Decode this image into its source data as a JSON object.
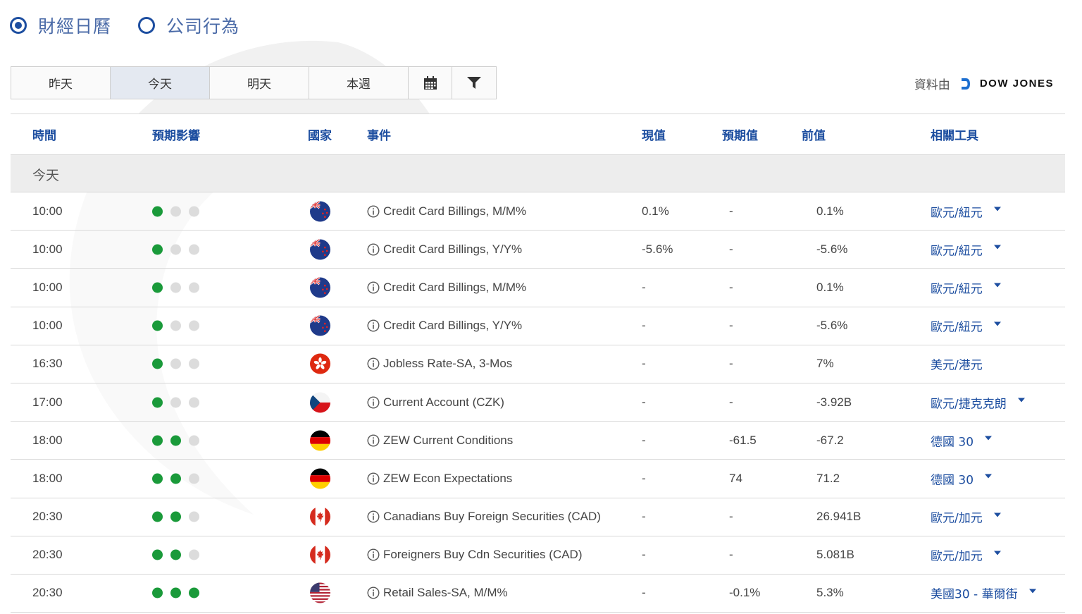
{
  "mode_options": [
    {
      "label": "財經日曆",
      "checked": true
    },
    {
      "label": "公司行為",
      "checked": false
    }
  ],
  "tabs": [
    {
      "label": "昨天",
      "active": false
    },
    {
      "label": "今天",
      "active": true
    },
    {
      "label": "明天",
      "active": false
    },
    {
      "label": "本週",
      "active": false
    }
  ],
  "toolbar_icons": [
    "calendar-icon",
    "filter-icon"
  ],
  "source": {
    "label": "資料由",
    "brand": "DOW JONES"
  },
  "table": {
    "headers": {
      "time": "時間",
      "impact": "預期影響",
      "country": "國家",
      "event": "事件",
      "actual": "現值",
      "forecast": "預期值",
      "previous": "前值",
      "instruments": "相關工具"
    },
    "group_label": "今天",
    "rows": [
      {
        "time": "10:00",
        "impact": 1,
        "country": "nz",
        "event": "Credit Card Billings, M/M%",
        "actual": "0.1%",
        "forecast": "-",
        "previous": "0.1%",
        "instrument": "歐元/紐元",
        "dropdown": true
      },
      {
        "time": "10:00",
        "impact": 1,
        "country": "nz",
        "event": "Credit Card Billings, Y/Y%",
        "actual": "-5.6%",
        "forecast": "-",
        "previous": "-5.6%",
        "instrument": "歐元/紐元",
        "dropdown": true
      },
      {
        "time": "10:00",
        "impact": 1,
        "country": "nz",
        "event": "Credit Card Billings, M/M%",
        "actual": "-",
        "forecast": "-",
        "previous": "0.1%",
        "instrument": "歐元/紐元",
        "dropdown": true
      },
      {
        "time": "10:00",
        "impact": 1,
        "country": "nz",
        "event": "Credit Card Billings, Y/Y%",
        "actual": "-",
        "forecast": "-",
        "previous": "-5.6%",
        "instrument": "歐元/紐元",
        "dropdown": true
      },
      {
        "time": "16:30",
        "impact": 1,
        "country": "hk",
        "event": "Jobless Rate-SA, 3-Mos",
        "actual": "-",
        "forecast": "-",
        "previous": "7%",
        "instrument": "美元/港元",
        "dropdown": false
      },
      {
        "time": "17:00",
        "impact": 1,
        "country": "cz",
        "event": "Current Account (CZK)",
        "actual": "-",
        "forecast": "-",
        "previous": "-3.92B",
        "instrument": "歐元/捷克克朗",
        "dropdown": true
      },
      {
        "time": "18:00",
        "impact": 2,
        "country": "de",
        "event": "ZEW Current Conditions",
        "actual": "-",
        "forecast": "-61.5",
        "previous": "-67.2",
        "instrument": "德國 30",
        "dropdown": true
      },
      {
        "time": "18:00",
        "impact": 2,
        "country": "de",
        "event": "ZEW Econ Expectations",
        "actual": "-",
        "forecast": "74",
        "previous": "71.2",
        "instrument": "德國 30",
        "dropdown": true
      },
      {
        "time": "20:30",
        "impact": 2,
        "country": "ca",
        "event": "Canadians Buy Foreign Securities (CAD)",
        "actual": "-",
        "forecast": "-",
        "previous": "26.941B",
        "instrument": "歐元/加元",
        "dropdown": true
      },
      {
        "time": "20:30",
        "impact": 2,
        "country": "ca",
        "event": "Foreigners Buy Cdn Securities (CAD)",
        "actual": "-",
        "forecast": "-",
        "previous": "5.081B",
        "instrument": "歐元/加元",
        "dropdown": true
      },
      {
        "time": "20:30",
        "impact": 3,
        "country": "us",
        "event": "Retail Sales-SA, M/M%",
        "actual": "-",
        "forecast": "-0.1%",
        "previous": "5.3%",
        "instrument": "美國30 - 華爾街",
        "dropdown": true
      }
    ]
  },
  "colors": {
    "accent": "#1d4ea0",
    "impact_on": "#1a9a3a",
    "impact_off": "#dcdcdc"
  }
}
